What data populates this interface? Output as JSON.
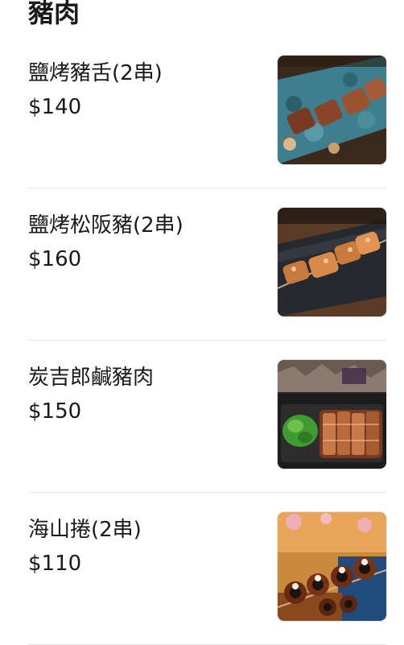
{
  "section": {
    "title": "豬肉"
  },
  "items": [
    {
      "name": "鹽烤豬舌(2串)",
      "price": "$140",
      "photo_icon": "grilled-pork-tongue-skewer-photo"
    },
    {
      "name": "鹽烤松阪豬(2串)",
      "price": "$160",
      "photo_icon": "grilled-pork-jowl-skewer-photo"
    },
    {
      "name": "炭吉郎鹹豬肉",
      "price": "$150",
      "photo_icon": "salted-pork-slices-photo"
    },
    {
      "name": "海山捲(2串)",
      "price": "$110",
      "photo_icon": "seaweed-pork-roll-skewer-photo"
    }
  ]
}
